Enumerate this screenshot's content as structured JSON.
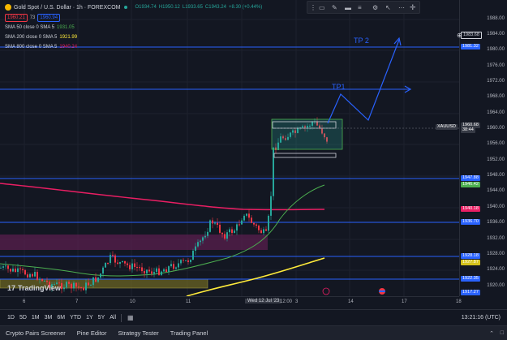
{
  "symbol": {
    "title": "Gold Spot / U.S. Dollar · 1h · FOREXCOM",
    "ohlc_o": "O1934.74",
    "ohlc_h": "H1950.12",
    "ohlc_l": "L1933.65",
    "ohlc_c": "C1943.24",
    "change": "+8.30 (+0.44%)",
    "bid": "1960.21",
    "spread": "73",
    "ask": "1960.94"
  },
  "indicators": [
    {
      "label": "SMA 50 close 0 SMA 5",
      "value": "1931.05",
      "color": "#4caf50"
    },
    {
      "label": "SMA 200 close 0 SMA 5",
      "value": "1921.99",
      "color": "#ffeb3b"
    },
    {
      "label": "SMA 800 close 0 SMA 5",
      "value": "1940.24",
      "color": "#e91e63"
    }
  ],
  "annotations": {
    "tp1": "TP1",
    "tp2": "TP 2"
  },
  "price_axis": {
    "ticks": [
      "1988.00",
      "1984.00",
      "1980.00",
      "1976.00",
      "1972.00",
      "1968.00",
      "1964.00",
      "1960.00",
      "1956.00",
      "1952.00",
      "1948.00",
      "1944.00",
      "1940.00",
      "1936.00",
      "1932.00",
      "1928.00",
      "1924.00",
      "1920.00"
    ],
    "tags": [
      {
        "text": "1983.68",
        "color": "#131722",
        "border": "#d1d4dc"
      },
      {
        "text": "1981.32",
        "color": "#2962ff"
      },
      {
        "text": "1960.68",
        "color": "#363a45"
      },
      {
        "text": "38:44",
        "color": "#363a45"
      },
      {
        "text": "1947.88",
        "color": "#2962ff"
      },
      {
        "text": "1946.42",
        "color": "#4caf50"
      },
      {
        "text": "1940.18",
        "color": "#e91e63"
      },
      {
        "text": "1936.70",
        "color": "#2962ff"
      },
      {
        "text": "1928.18",
        "color": "#2962ff"
      },
      {
        "text": "1927.87",
        "color": "#d4c21a"
      },
      {
        "text": "1922.35",
        "color": "#2962ff"
      },
      {
        "text": "1917.27",
        "color": "#2962ff"
      }
    ],
    "symbol_tag": "XAUUSD"
  },
  "time_axis": {
    "labels": [
      "6",
      "7",
      "10",
      "11",
      "Wed 12 Jul '23",
      "12:00",
      "3",
      "14",
      "17",
      "18"
    ],
    "clock": "13:21:16 (UTC)"
  },
  "toolbar": {
    "ranges": [
      "1D",
      "5D",
      "1M",
      "3M",
      "6M",
      "YTD",
      "1Y",
      "5Y",
      "All"
    ]
  },
  "tabs": [
    "Crypto Pairs Screener",
    "Pine Editor",
    "Strategy Tester",
    "Trading Panel"
  ],
  "logo": "TradingView"
}
